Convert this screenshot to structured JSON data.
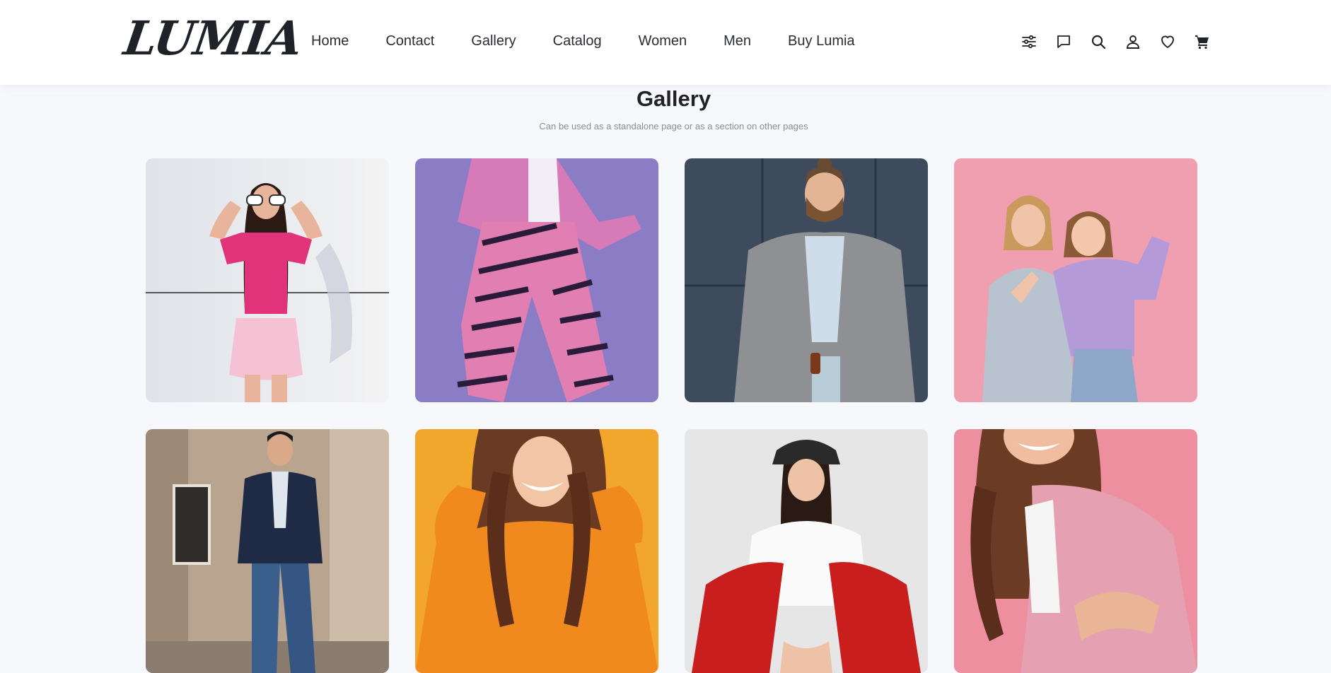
{
  "brand": {
    "name": "LUMIA"
  },
  "nav": {
    "items": [
      {
        "label": "Home"
      },
      {
        "label": "Contact"
      },
      {
        "label": "Gallery"
      },
      {
        "label": "Catalog"
      },
      {
        "label": "Women"
      },
      {
        "label": "Men"
      },
      {
        "label": "Buy Lumia"
      }
    ]
  },
  "header_icons": [
    "sliders-icon",
    "chat-icon",
    "search-icon",
    "user-icon",
    "heart-icon",
    "cart-icon"
  ],
  "page": {
    "title": "Gallery",
    "subtitle": "Can be used as a standalone page or as a section on other pages"
  },
  "gallery": {
    "photos": [
      {
        "name": "woman-pink-top-sunglasses",
        "background": "#e4e8ee",
        "accent": "#e0337a"
      },
      {
        "name": "pink-coat-striped-pants",
        "background": "#8b7cc6",
        "accent": "#d77ab8"
      },
      {
        "name": "man-plaid-blazer",
        "background": "#3d4b5c",
        "accent": "#8e9093"
      },
      {
        "name": "two-women-laughing",
        "background": "#ef9fb0",
        "accent": "#b59ad9"
      },
      {
        "name": "man-navy-blazer-jeans",
        "background": "#b9a48f",
        "accent": "#1f2b44"
      },
      {
        "name": "woman-orange-sweater",
        "background": "#f2a72c",
        "accent": "#f08a1e"
      },
      {
        "name": "woman-red-jacket-hat",
        "background": "#e6e6e6",
        "accent": "#c81e1e"
      },
      {
        "name": "woman-pink-blazer",
        "background": "#ee8f9f",
        "accent": "#e5a0b1"
      }
    ]
  }
}
